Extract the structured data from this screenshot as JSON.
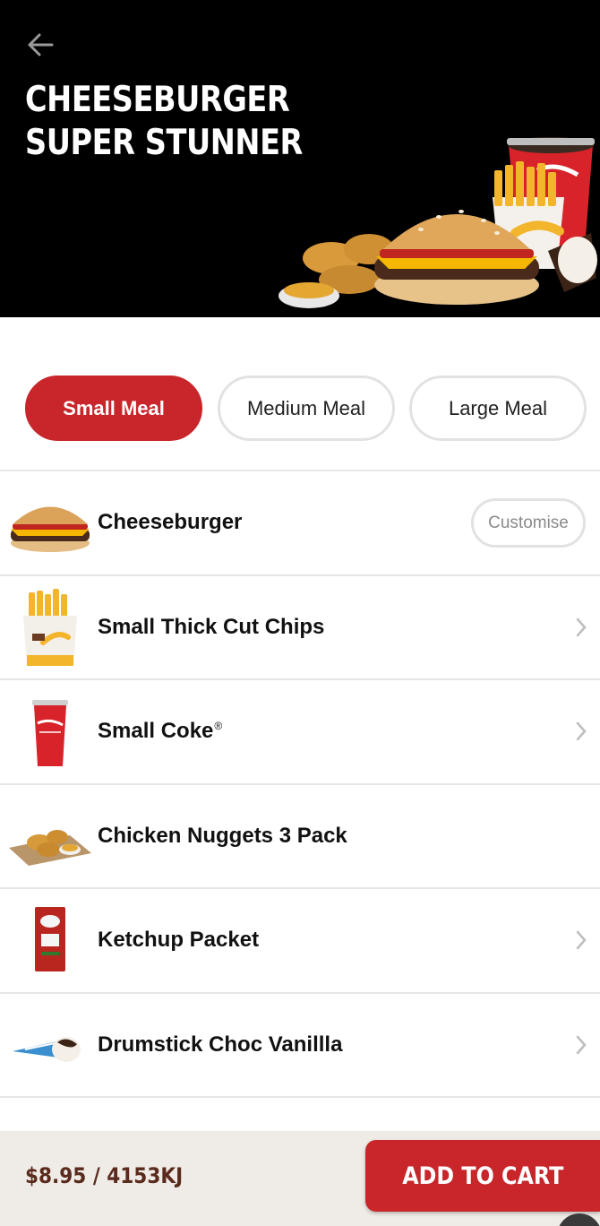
{
  "header": {
    "back_icon": "arrow-left-icon",
    "title_line1": "CHEESEBURGER",
    "title_line2": "SUPER STUNNER"
  },
  "sizes": {
    "options": [
      "Small Meal",
      "Medium Meal",
      "Large Meal"
    ],
    "selected": "Small Meal"
  },
  "items": [
    {
      "name": "Cheeseburger",
      "action": "Customise"
    },
    {
      "name": "Small Thick Cut Chips",
      "icon": "chevron-right-icon"
    },
    {
      "name": "Small Coke",
      "mark": "®",
      "icon": "chevron-right-icon"
    },
    {
      "name": "Chicken Nuggets 3 Pack"
    },
    {
      "name": "Ketchup Packet",
      "icon": "chevron-right-icon"
    },
    {
      "name": "Drumstick Choc Vanillla",
      "icon": "chevron-right-icon"
    }
  ],
  "footer": {
    "price_energy": "$8.95 / 4153KJ",
    "add_to_cart": "ADD TO CART"
  },
  "colors": {
    "brand_red": "#c8262b",
    "price_brown": "#5a2b1c",
    "footer_bg": "#efebe7"
  }
}
